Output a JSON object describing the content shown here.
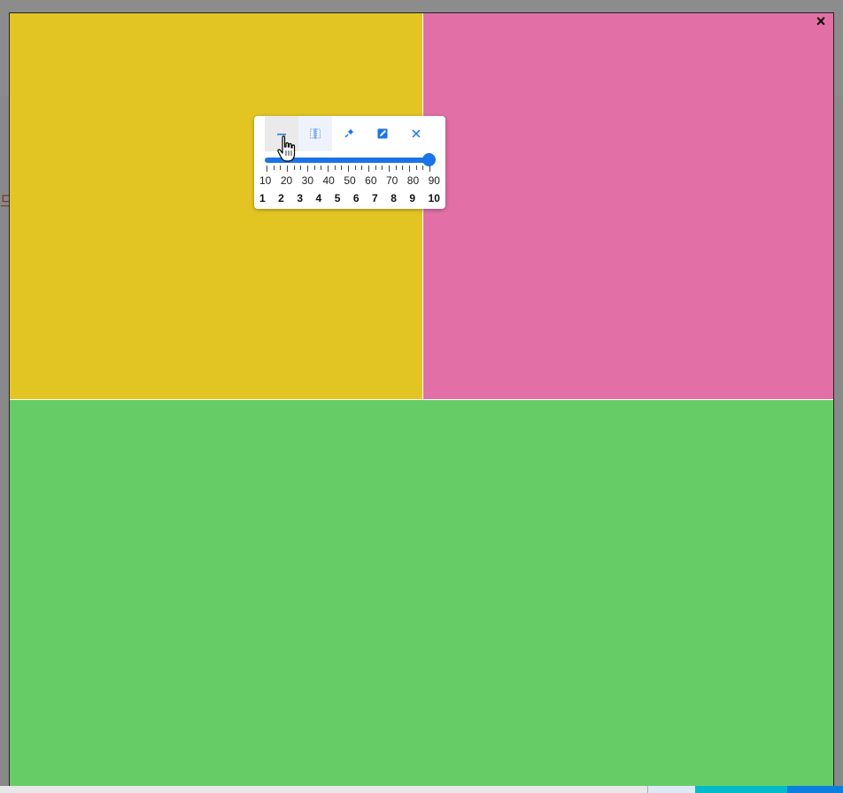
{
  "backdrop": {
    "glyph": "므"
  },
  "modal": {
    "close_label": "×"
  },
  "panes": {
    "yellow": "#E2C523",
    "pink": "#E26FA6",
    "green": "#66CD66"
  },
  "toolbar": {
    "buttons": [
      {
        "name": "horizontal-split-icon",
        "active": true
      },
      {
        "name": "vertical-split-icon",
        "active": false
      },
      {
        "name": "magic-wand-icon",
        "active": false
      },
      {
        "name": "edit-icon",
        "active": false
      },
      {
        "name": "close-icon",
        "active": false
      }
    ],
    "slider": {
      "value": 90,
      "min": 10,
      "max": 90
    },
    "scale_top": [
      "10",
      "20",
      "30",
      "40",
      "50",
      "60",
      "70",
      "80",
      "90"
    ],
    "scale_bottom": [
      "1",
      "2",
      "3",
      "4",
      "5",
      "6",
      "7",
      "8",
      "9",
      "10"
    ]
  },
  "accent_color": "#1A73E8"
}
